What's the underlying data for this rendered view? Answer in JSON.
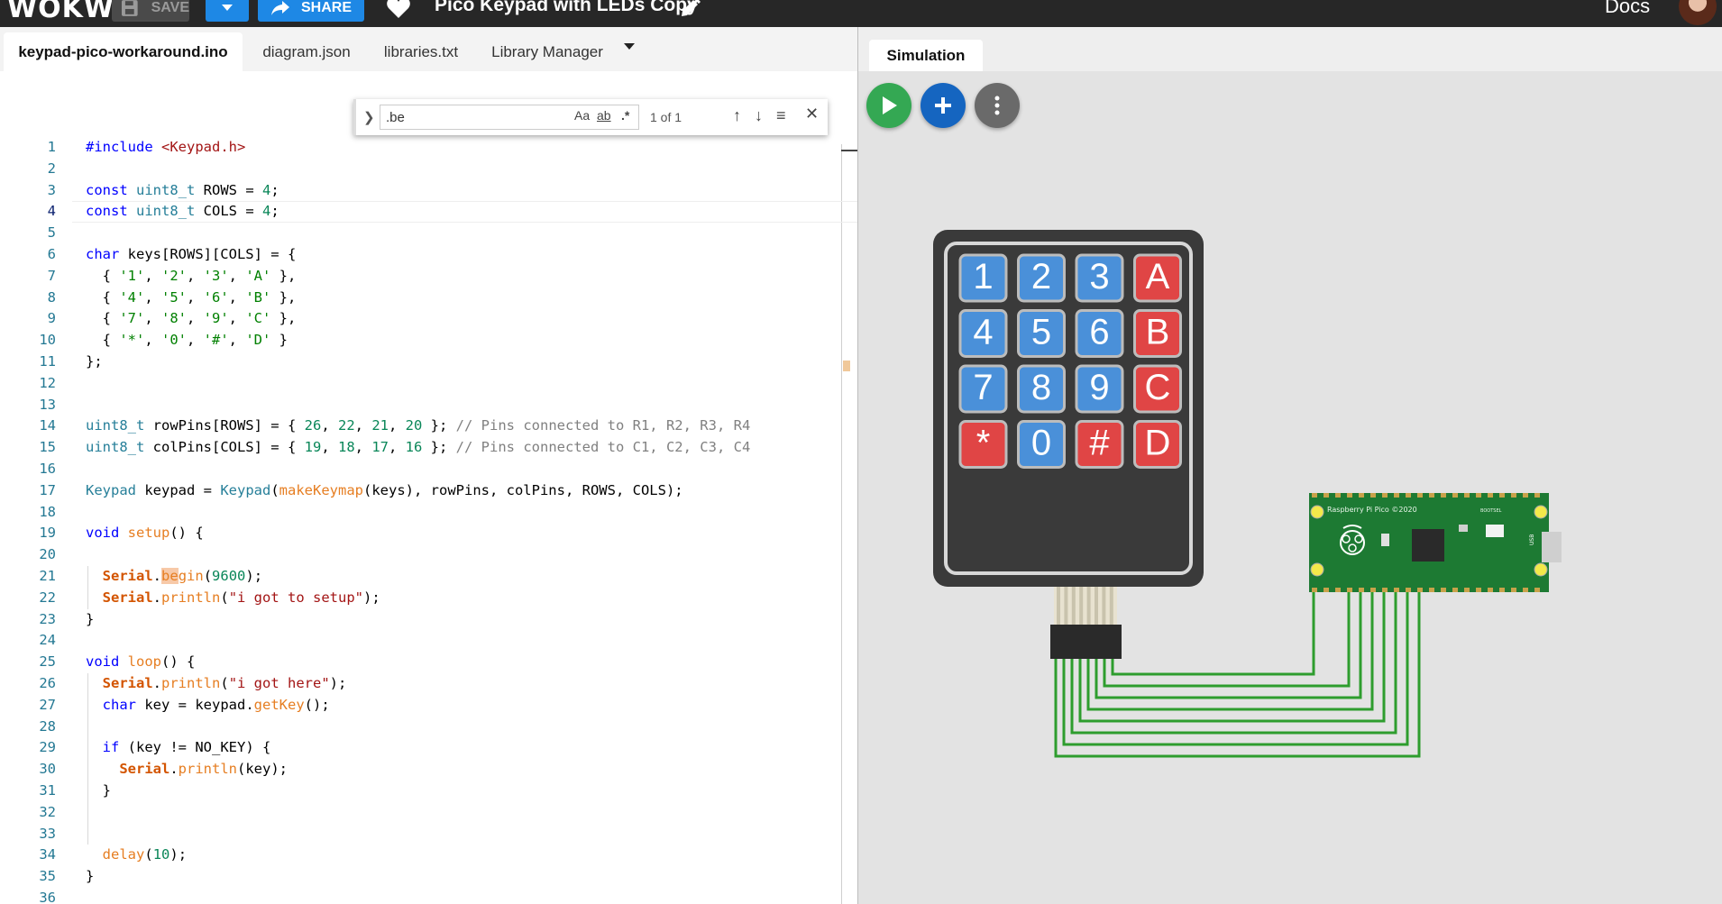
{
  "topbar": {
    "logo": "WOKWI",
    "save_label": "SAVE",
    "share_label": "SHARE",
    "project_title": "Pico Keypad with LEDs Copy",
    "docs_label": "Docs"
  },
  "tabs": [
    {
      "label": "keypad-pico-workaround.ino",
      "active": true
    },
    {
      "label": "diagram.json",
      "active": false
    },
    {
      "label": "libraries.txt",
      "active": false
    },
    {
      "label": "Library Manager",
      "active": false
    }
  ],
  "find": {
    "query": ".be",
    "match_case_label": "Aa",
    "whole_word_label": "ab",
    "regex_label": ".*",
    "match_count": "1 of 1"
  },
  "code": {
    "current_line": 4,
    "lines": [
      "#include <Keypad.h>",
      "",
      "const uint8_t ROWS = 4;",
      "const uint8_t COLS = 4;",
      "",
      "char keys[ROWS][COLS] = {",
      "  { '1', '2', '3', 'A' },",
      "  { '4', '5', '6', 'B' },",
      "  { '7', '8', '9', 'C' },",
      "  { '*', '0', '#', 'D' }",
      "};",
      "",
      "",
      "uint8_t rowPins[ROWS] = { 26, 22, 21, 20 }; // Pins connected to R1, R2, R3, R4",
      "uint8_t colPins[COLS] = { 19, 18, 17, 16 }; // Pins connected to C1, C2, C3, C4",
      "",
      "Keypad keypad = Keypad(makeKeymap(keys), rowPins, colPins, ROWS, COLS);",
      "",
      "void setup() {",
      "",
      "  Serial.begin(9600);",
      "  Serial.println(\"i got to setup\");",
      "}",
      "",
      "void loop() {",
      "  Serial.println(\"i got here\");",
      "  char key = keypad.getKey();",
      "",
      "  if (key != NO_KEY) {",
      "    Serial.println(key);",
      "  }",
      "",
      "",
      "  delay(10);",
      "}",
      ""
    ]
  },
  "simulation": {
    "tab_label": "Simulation",
    "keypad": {
      "keys": [
        [
          {
            "label": "1",
            "color": "#4a90d9"
          },
          {
            "label": "2",
            "color": "#4a90d9"
          },
          {
            "label": "3",
            "color": "#4a90d9"
          },
          {
            "label": "A",
            "color": "#e04545"
          }
        ],
        [
          {
            "label": "4",
            "color": "#4a90d9"
          },
          {
            "label": "5",
            "color": "#4a90d9"
          },
          {
            "label": "6",
            "color": "#4a90d9"
          },
          {
            "label": "B",
            "color": "#e04545"
          }
        ],
        [
          {
            "label": "7",
            "color": "#4a90d9"
          },
          {
            "label": "8",
            "color": "#4a90d9"
          },
          {
            "label": "9",
            "color": "#4a90d9"
          },
          {
            "label": "C",
            "color": "#e04545"
          }
        ],
        [
          {
            "label": "*",
            "color": "#e04545"
          },
          {
            "label": "0",
            "color": "#4a90d9"
          },
          {
            "label": "#",
            "color": "#e04545"
          },
          {
            "label": "D",
            "color": "#e04545"
          }
        ]
      ]
    },
    "pico": {
      "board_label": "Raspberry Pi Pico ©2020",
      "bootsel_label": "BOOTSEL"
    },
    "wire_color": "#2e9d2e"
  },
  "colors": {
    "topbar_bg": "#272727",
    "accent_blue": "#1e88e5",
    "play_green": "#34a853",
    "pico_green": "#1d7a33"
  }
}
